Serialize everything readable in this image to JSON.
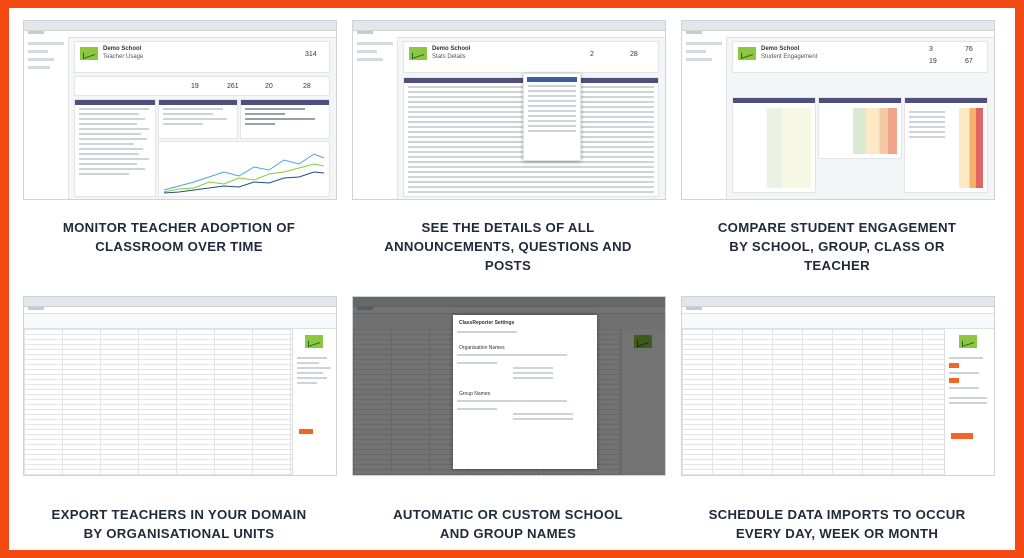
{
  "colors": {
    "border": "#f24a12",
    "caption": "#1f2a3b",
    "accent_green": "#8ec63f",
    "header_purple": "#4e4f7a"
  },
  "panels": [
    {
      "caption_lines": [
        "MONITOR TEACHER ADOPTION OF",
        "CLASSROOM OVER TIME"
      ],
      "screen": {
        "school": "Demo School",
        "view": "Teacher Usage",
        "stats": [
          "314",
          "19",
          "261",
          "20",
          "28"
        ]
      }
    },
    {
      "caption_lines": [
        "SEE THE DETAILS OF ALL",
        "ANNOUNCEMENTS, QUESTIONS AND",
        "POSTS"
      ],
      "screen": {
        "school": "Demo School",
        "view": "Stats Details",
        "stats": [
          "2",
          "28"
        ]
      }
    },
    {
      "caption_lines": [
        "COMPARE STUDENT ENGAGEMENT",
        "BY SCHOOL, GROUP, CLASS OR",
        "TEACHER"
      ],
      "screen": {
        "school": "Demo School",
        "view": "Student Engagement",
        "stats": [
          "3",
          "76",
          "19",
          "67"
        ]
      }
    },
    {
      "caption_lines": [
        "EXPORT TEACHERS IN YOUR DOMAIN",
        "BY ORGANISATIONAL UNITS"
      ],
      "screen": {
        "app": "ClassReporter"
      }
    },
    {
      "caption_lines": [
        "AUTOMATIC OR CUSTOM SCHOOL",
        "AND GROUP NAMES"
      ],
      "screen": {
        "dialog_title": "ClassReporter Settings",
        "section_1": "Organisation Names",
        "section_2": "Group Names"
      }
    },
    {
      "caption_lines": [
        "SCHEDULE DATA IMPORTS TO OCCUR",
        "EVERY DAY, WEEK OR MONTH"
      ],
      "screen": {
        "app": "ClassReporter"
      }
    }
  ]
}
